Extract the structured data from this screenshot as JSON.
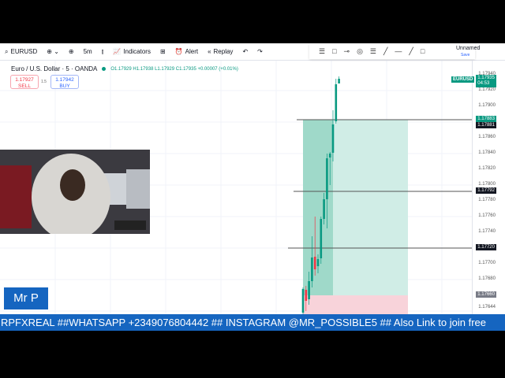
{
  "toolbar": {
    "symbol": "EURUSD",
    "interval": "5m",
    "indicators": "Indicators",
    "alert": "Alert",
    "replay": "Replay",
    "layout_name": "Unnamed",
    "layout_status": "Save"
  },
  "legend": {
    "title": "Euro / U.S. Dollar · 5 · OANDA",
    "ohlc": "O1.17929 H1.17938 L1.17929 C1.17935 +0.00007 (+0.01%)"
  },
  "trade": {
    "sell_price": "1.17927",
    "sell_label": "SELL",
    "spread": "1.5",
    "buy_price": "1.17942",
    "buy_label": "BUY"
  },
  "axis": {
    "ticks": [
      "1.17940",
      "1.17920",
      "1.17900",
      "1.17860",
      "1.17840",
      "1.17820",
      "1.17800",
      "1.17780",
      "1.17760",
      "1.17740",
      "1.17700",
      "1.17680",
      "1.17644"
    ],
    "last_symbol": "EURUSD",
    "last_price": "1.17935",
    "countdown": "04:53",
    "labels": [
      {
        "text": "1.17883",
        "color": "#089981"
      },
      {
        "text": "1.17881",
        "color": "#131722"
      },
      {
        "text": "1.17792",
        "color": "#131722"
      },
      {
        "text": "1.17720",
        "color": "#131722"
      },
      {
        "text": "1.17660",
        "color": "#787b86"
      }
    ]
  },
  "chart_data": {
    "type": "candlestick",
    "ylim": [
      1.17644,
      1.1794
    ],
    "candles": [
      [
        1.17638,
        1.17668,
        1.1763,
        1.1767
      ],
      [
        1.17667,
        1.17653,
        1.1764,
        1.17672
      ],
      [
        1.17655,
        1.17678,
        1.17648,
        1.1769
      ],
      [
        1.17678,
        1.17708,
        1.1767,
        1.17735
      ],
      [
        1.17709,
        1.17693,
        1.17685,
        1.1776
      ],
      [
        1.17697,
        1.17706,
        1.17688,
        1.17712
      ],
      [
        1.17707,
        1.17757,
        1.177,
        1.1776
      ],
      [
        1.17757,
        1.17782,
        1.1775,
        1.1779
      ],
      [
        1.17782,
        1.17834,
        1.17745,
        1.1784
      ],
      [
        1.17835,
        1.1784,
        1.178,
        1.17842
      ],
      [
        1.17841,
        1.17877,
        1.1783,
        1.17895
      ],
      [
        1.17881,
        1.17928,
        1.17878,
        1.17935
      ],
      [
        1.17929,
        1.17935,
        1.17929,
        1.17938
      ]
    ],
    "position": {
      "target": 1.17883,
      "entry": 1.1766,
      "stop": 1.176
    },
    "hlines": [
      1.17883,
      1.17792,
      1.1772
    ]
  },
  "overlay": {
    "name_tag": "Mr P",
    "banner": "RPFXREAL ##WHATSAPP +2349076804442 ## INSTAGRAM @MR_POSSIBLE5 ## Also Link to join free"
  },
  "colors": {
    "up": "#089981",
    "down": "#f23645",
    "banner": "#1565c0"
  }
}
